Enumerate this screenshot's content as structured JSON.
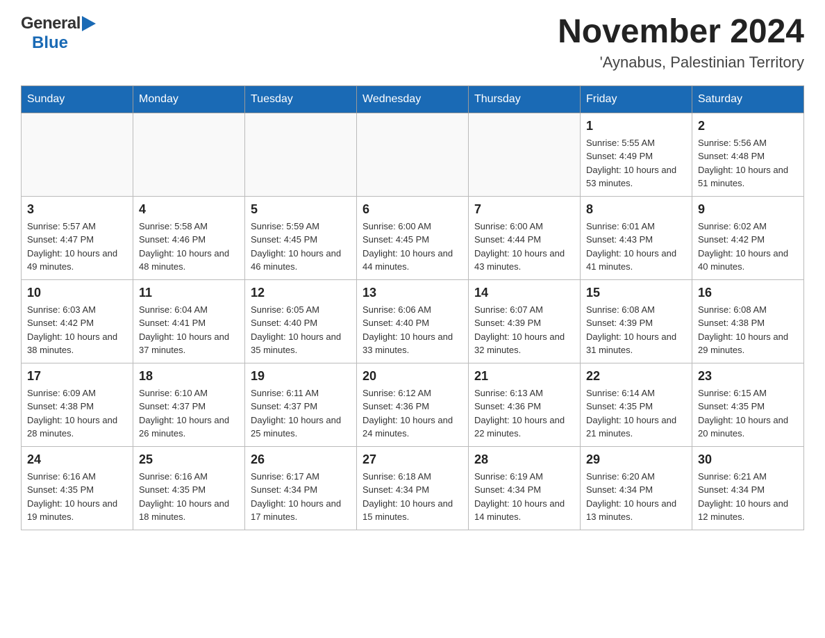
{
  "header": {
    "logo_general": "General",
    "logo_blue": "Blue",
    "month_title": "November 2024",
    "location": "'Aynabus, Palestinian Territory"
  },
  "weekdays": [
    "Sunday",
    "Monday",
    "Tuesday",
    "Wednesday",
    "Thursday",
    "Friday",
    "Saturday"
  ],
  "weeks": [
    [
      {
        "day": "",
        "sunrise": "",
        "sunset": "",
        "daylight": ""
      },
      {
        "day": "",
        "sunrise": "",
        "sunset": "",
        "daylight": ""
      },
      {
        "day": "",
        "sunrise": "",
        "sunset": "",
        "daylight": ""
      },
      {
        "day": "",
        "sunrise": "",
        "sunset": "",
        "daylight": ""
      },
      {
        "day": "",
        "sunrise": "",
        "sunset": "",
        "daylight": ""
      },
      {
        "day": "1",
        "sunrise": "Sunrise: 5:55 AM",
        "sunset": "Sunset: 4:49 PM",
        "daylight": "Daylight: 10 hours and 53 minutes."
      },
      {
        "day": "2",
        "sunrise": "Sunrise: 5:56 AM",
        "sunset": "Sunset: 4:48 PM",
        "daylight": "Daylight: 10 hours and 51 minutes."
      }
    ],
    [
      {
        "day": "3",
        "sunrise": "Sunrise: 5:57 AM",
        "sunset": "Sunset: 4:47 PM",
        "daylight": "Daylight: 10 hours and 49 minutes."
      },
      {
        "day": "4",
        "sunrise": "Sunrise: 5:58 AM",
        "sunset": "Sunset: 4:46 PM",
        "daylight": "Daylight: 10 hours and 48 minutes."
      },
      {
        "day": "5",
        "sunrise": "Sunrise: 5:59 AM",
        "sunset": "Sunset: 4:45 PM",
        "daylight": "Daylight: 10 hours and 46 minutes."
      },
      {
        "day": "6",
        "sunrise": "Sunrise: 6:00 AM",
        "sunset": "Sunset: 4:45 PM",
        "daylight": "Daylight: 10 hours and 44 minutes."
      },
      {
        "day": "7",
        "sunrise": "Sunrise: 6:00 AM",
        "sunset": "Sunset: 4:44 PM",
        "daylight": "Daylight: 10 hours and 43 minutes."
      },
      {
        "day": "8",
        "sunrise": "Sunrise: 6:01 AM",
        "sunset": "Sunset: 4:43 PM",
        "daylight": "Daylight: 10 hours and 41 minutes."
      },
      {
        "day": "9",
        "sunrise": "Sunrise: 6:02 AM",
        "sunset": "Sunset: 4:42 PM",
        "daylight": "Daylight: 10 hours and 40 minutes."
      }
    ],
    [
      {
        "day": "10",
        "sunrise": "Sunrise: 6:03 AM",
        "sunset": "Sunset: 4:42 PM",
        "daylight": "Daylight: 10 hours and 38 minutes."
      },
      {
        "day": "11",
        "sunrise": "Sunrise: 6:04 AM",
        "sunset": "Sunset: 4:41 PM",
        "daylight": "Daylight: 10 hours and 37 minutes."
      },
      {
        "day": "12",
        "sunrise": "Sunrise: 6:05 AM",
        "sunset": "Sunset: 4:40 PM",
        "daylight": "Daylight: 10 hours and 35 minutes."
      },
      {
        "day": "13",
        "sunrise": "Sunrise: 6:06 AM",
        "sunset": "Sunset: 4:40 PM",
        "daylight": "Daylight: 10 hours and 33 minutes."
      },
      {
        "day": "14",
        "sunrise": "Sunrise: 6:07 AM",
        "sunset": "Sunset: 4:39 PM",
        "daylight": "Daylight: 10 hours and 32 minutes."
      },
      {
        "day": "15",
        "sunrise": "Sunrise: 6:08 AM",
        "sunset": "Sunset: 4:39 PM",
        "daylight": "Daylight: 10 hours and 31 minutes."
      },
      {
        "day": "16",
        "sunrise": "Sunrise: 6:08 AM",
        "sunset": "Sunset: 4:38 PM",
        "daylight": "Daylight: 10 hours and 29 minutes."
      }
    ],
    [
      {
        "day": "17",
        "sunrise": "Sunrise: 6:09 AM",
        "sunset": "Sunset: 4:38 PM",
        "daylight": "Daylight: 10 hours and 28 minutes."
      },
      {
        "day": "18",
        "sunrise": "Sunrise: 6:10 AM",
        "sunset": "Sunset: 4:37 PM",
        "daylight": "Daylight: 10 hours and 26 minutes."
      },
      {
        "day": "19",
        "sunrise": "Sunrise: 6:11 AM",
        "sunset": "Sunset: 4:37 PM",
        "daylight": "Daylight: 10 hours and 25 minutes."
      },
      {
        "day": "20",
        "sunrise": "Sunrise: 6:12 AM",
        "sunset": "Sunset: 4:36 PM",
        "daylight": "Daylight: 10 hours and 24 minutes."
      },
      {
        "day": "21",
        "sunrise": "Sunrise: 6:13 AM",
        "sunset": "Sunset: 4:36 PM",
        "daylight": "Daylight: 10 hours and 22 minutes."
      },
      {
        "day": "22",
        "sunrise": "Sunrise: 6:14 AM",
        "sunset": "Sunset: 4:35 PM",
        "daylight": "Daylight: 10 hours and 21 minutes."
      },
      {
        "day": "23",
        "sunrise": "Sunrise: 6:15 AM",
        "sunset": "Sunset: 4:35 PM",
        "daylight": "Daylight: 10 hours and 20 minutes."
      }
    ],
    [
      {
        "day": "24",
        "sunrise": "Sunrise: 6:16 AM",
        "sunset": "Sunset: 4:35 PM",
        "daylight": "Daylight: 10 hours and 19 minutes."
      },
      {
        "day": "25",
        "sunrise": "Sunrise: 6:16 AM",
        "sunset": "Sunset: 4:35 PM",
        "daylight": "Daylight: 10 hours and 18 minutes."
      },
      {
        "day": "26",
        "sunrise": "Sunrise: 6:17 AM",
        "sunset": "Sunset: 4:34 PM",
        "daylight": "Daylight: 10 hours and 17 minutes."
      },
      {
        "day": "27",
        "sunrise": "Sunrise: 6:18 AM",
        "sunset": "Sunset: 4:34 PM",
        "daylight": "Daylight: 10 hours and 15 minutes."
      },
      {
        "day": "28",
        "sunrise": "Sunrise: 6:19 AM",
        "sunset": "Sunset: 4:34 PM",
        "daylight": "Daylight: 10 hours and 14 minutes."
      },
      {
        "day": "29",
        "sunrise": "Sunrise: 6:20 AM",
        "sunset": "Sunset: 4:34 PM",
        "daylight": "Daylight: 10 hours and 13 minutes."
      },
      {
        "day": "30",
        "sunrise": "Sunrise: 6:21 AM",
        "sunset": "Sunset: 4:34 PM",
        "daylight": "Daylight: 10 hours and 12 minutes."
      }
    ]
  ]
}
